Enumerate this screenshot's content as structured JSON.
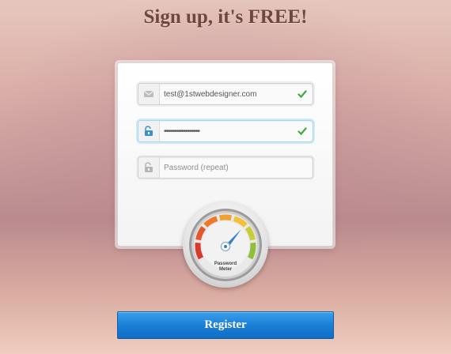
{
  "header": {
    "title": "Sign up, it's FREE!"
  },
  "form": {
    "email": {
      "value": "test@1stwebdesigner.com",
      "placeholder": ""
    },
    "password": {
      "value": "••••••••••••••••••",
      "placeholder": ""
    },
    "password_repeat": {
      "value": "",
      "placeholder": "Password (repeat)"
    }
  },
  "meter": {
    "label_line1": "Password",
    "label_line2": "Meter"
  },
  "actions": {
    "register_label": "Register"
  },
  "icons": {
    "email": "mail-icon",
    "password": "unlock-icon",
    "password_repeat": "unlock-icon",
    "valid": "check-icon"
  },
  "colors": {
    "accent": "#1b7fd6",
    "valid": "#3bab3b",
    "title": "#6e463c"
  }
}
